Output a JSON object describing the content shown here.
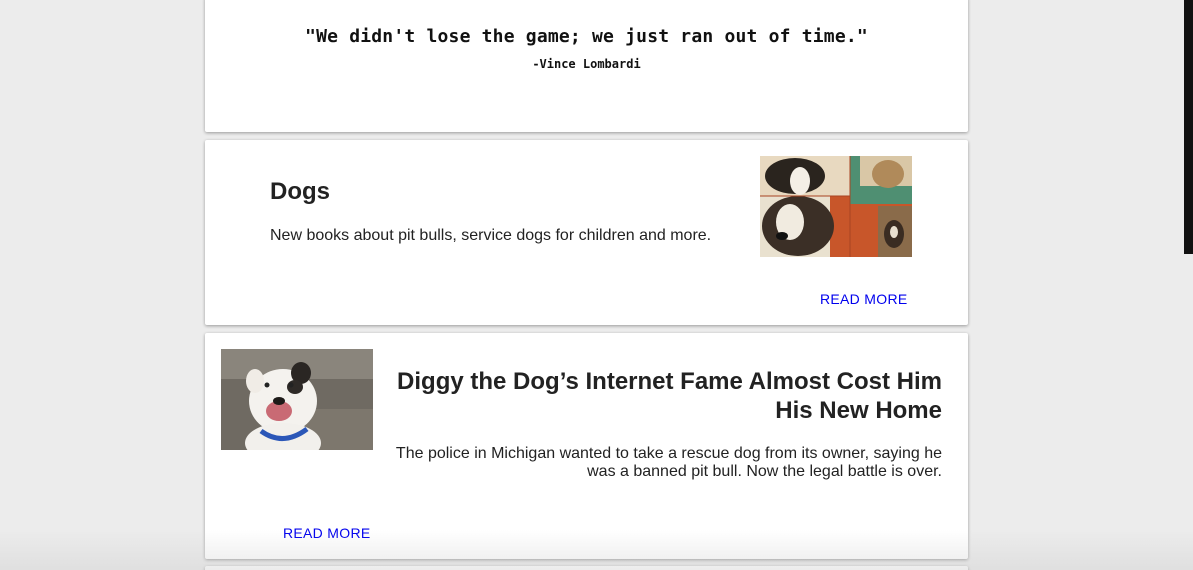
{
  "quote": {
    "text": "\"We didn't lose the game; we just ran out of time.\"",
    "author": "-Vince Lombardi"
  },
  "dogs_card": {
    "title": "Dogs",
    "description": "New books about pit bulls, service dogs for children and more.",
    "read_more": "READ MORE"
  },
  "diggy_card": {
    "title": "Diggy the Dog’s Internet Fame Almost Cost Him His New Home",
    "description": "The police in Michigan wanted to take a rescue dog from its owner, saying he was a banned pit bull. Now the legal battle is over.",
    "read_more": "READ MORE"
  },
  "colors": {
    "link": "#0000ee",
    "page_background": "#ececec",
    "card_background": "#ffffff"
  }
}
